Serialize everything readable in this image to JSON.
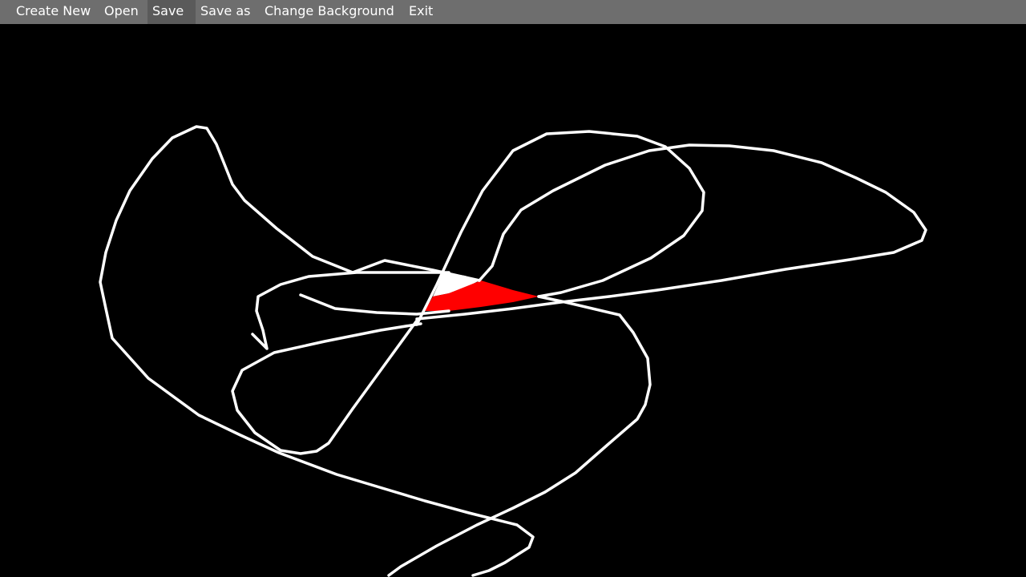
{
  "menu": {
    "items": [
      {
        "label": "Create New"
      },
      {
        "label": "Open"
      },
      {
        "label": "Save"
      },
      {
        "label": "Save as"
      },
      {
        "label": "Change Background"
      },
      {
        "label": "Exit"
      }
    ],
    "active_item": "Save"
  },
  "canvas": {
    "background_color": "#000000",
    "stroke_color": "#ffffff",
    "fill_colors": [
      "#ffffff",
      "#ff0000"
    ]
  },
  "colors": {
    "menubar": "#6e6e6e",
    "menu_active": "#5a5a5a",
    "menu_text": "#ffffff"
  }
}
